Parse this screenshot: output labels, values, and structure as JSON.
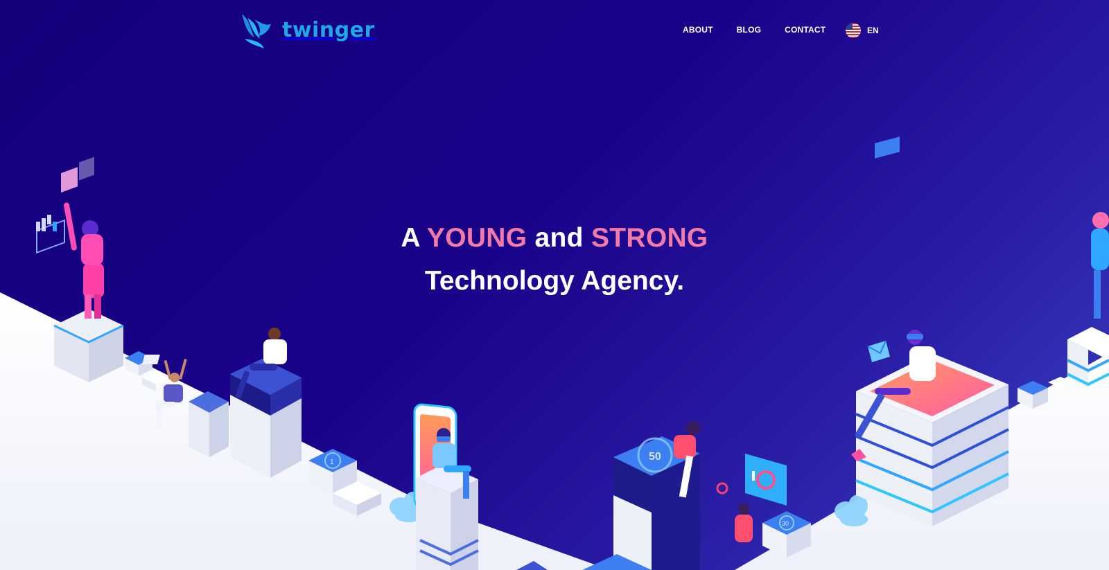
{
  "brand": {
    "name": "twinger"
  },
  "nav": {
    "items": [
      {
        "label": "ABOUT"
      },
      {
        "label": "BLOG"
      },
      {
        "label": "CONTACT"
      }
    ],
    "language": {
      "label": "EN",
      "flag": "us-flag-icon"
    }
  },
  "hero": {
    "line1": {
      "word1": "A",
      "word2": "YOUNG",
      "word3": "and",
      "word4": "STRONG"
    },
    "line2": "Technology Agency."
  },
  "illustration": {
    "device_numbers": {
      "left_disc": "1",
      "center_disc": "50",
      "right_disc": "30"
    }
  },
  "colors": {
    "background_start": "#14007a",
    "background_end": "#3a44c6",
    "accent_pink": "#f27aa8",
    "brand_blue": "#21a6e8"
  }
}
